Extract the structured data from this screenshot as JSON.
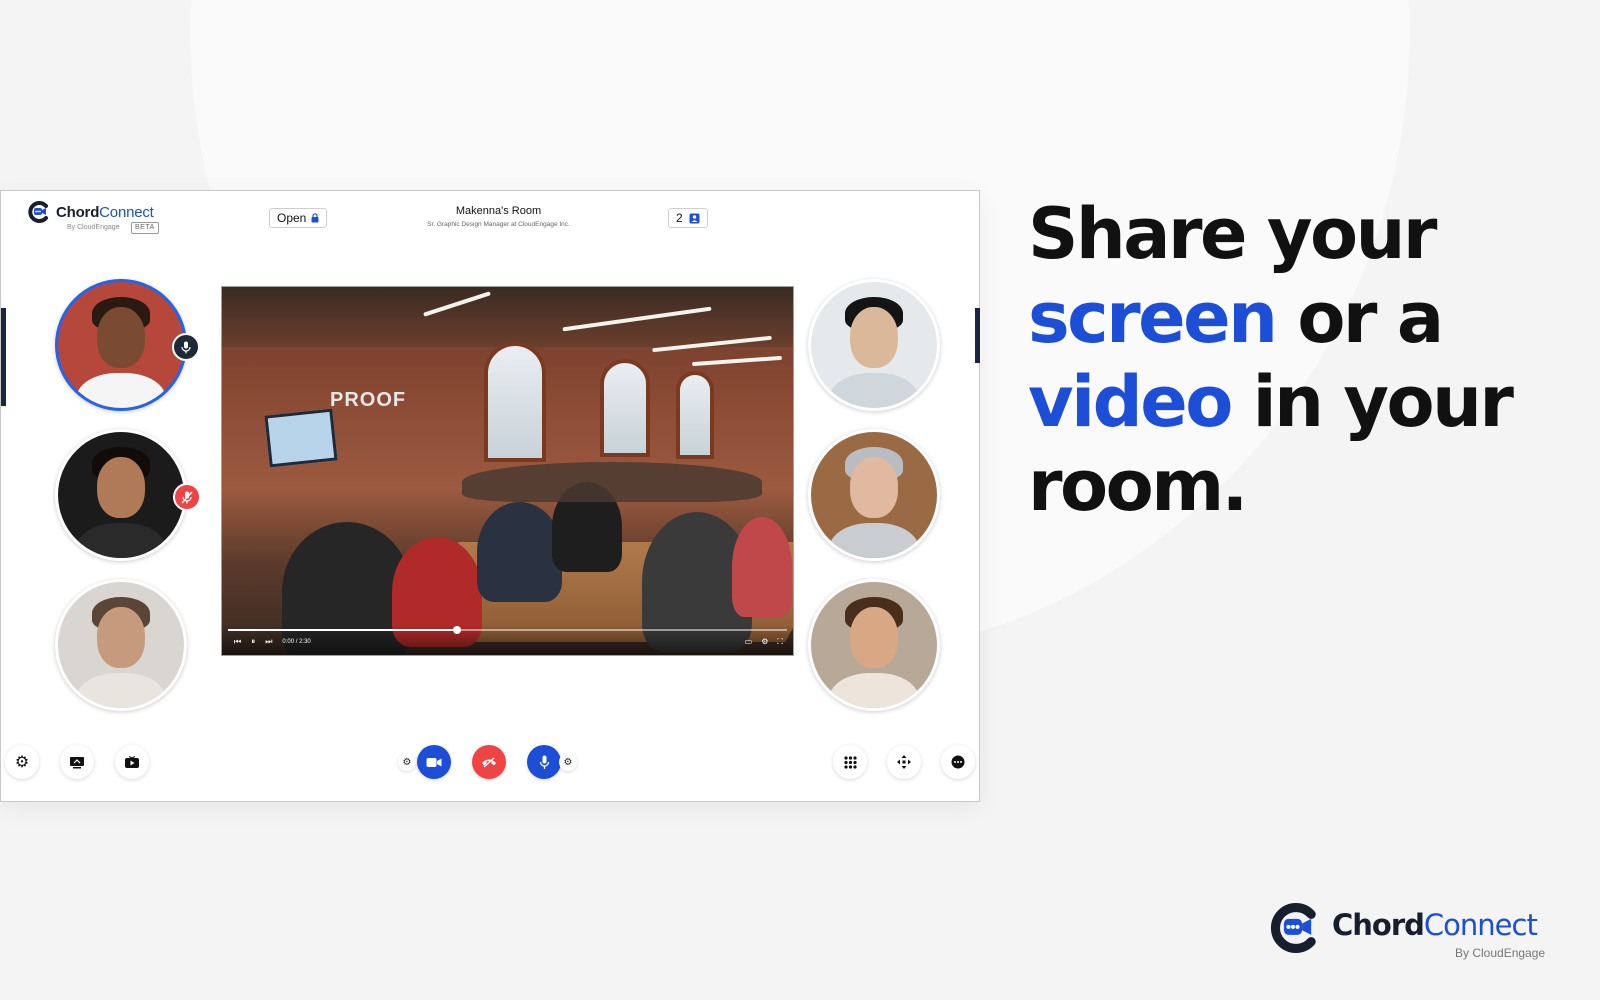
{
  "app": {
    "brand": {
      "name_bold": "Chord",
      "name_light": "Connect",
      "by": "By CloudEngage",
      "badge": "BETA"
    },
    "header": {
      "lock_status": "Open",
      "room_title": "Makenna's Room",
      "room_subtitle": "Sr. Graphic Design Manager at CloudEngage Inc.",
      "participant_count": "2"
    },
    "video": {
      "time": "0:00 / 2:30",
      "progress": 0.41,
      "sign_text": "PROOF"
    }
  },
  "marketing": {
    "headline": {
      "line1": "Share your",
      "word_screen": "screen",
      "line2_rest": " or a",
      "word_video": "video",
      "line3_rest": " in your",
      "line4": "room."
    },
    "footer_logo": {
      "name_bold": "Chord",
      "name_light": "Connect",
      "by": "By CloudEngage"
    }
  },
  "colors": {
    "accent": "#1d4ed8",
    "danger": "#ef4444",
    "dark": "#171f2e"
  }
}
